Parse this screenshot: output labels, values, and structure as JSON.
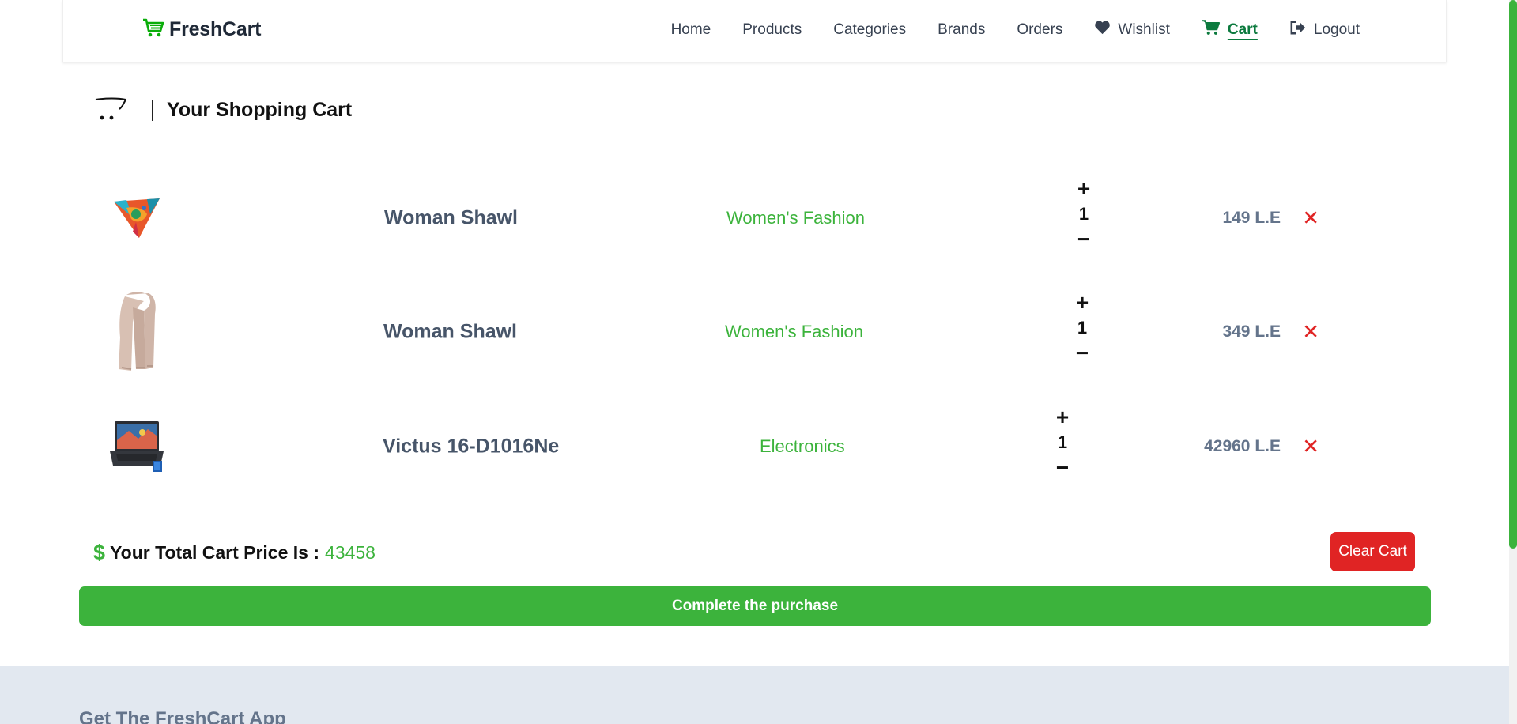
{
  "brand": {
    "name": "FreshCart",
    "icon": "shopping-cart-icon",
    "color": "#0aad0a"
  },
  "nav": {
    "items": [
      {
        "label": "Home"
      },
      {
        "label": "Products"
      },
      {
        "label": "Categories"
      },
      {
        "label": "Brands"
      },
      {
        "label": "Orders"
      },
      {
        "label": "Wishlist",
        "icon": "heart-icon"
      },
      {
        "label": "Cart",
        "icon": "cart-icon",
        "active": true
      },
      {
        "label": "Logout",
        "icon": "logout-icon"
      }
    ]
  },
  "cart": {
    "title": "Your Shopping Cart",
    "icon": "cart-outline-icon",
    "items": [
      {
        "name": "Woman Shawl",
        "category": "Women's Fashion",
        "quantity": "1",
        "price": "149 L.E",
        "image": "colorful-shawl-image"
      },
      {
        "name": "Woman Shawl",
        "category": "Women's Fashion",
        "quantity": "1",
        "price": "349 L.E",
        "image": "beige-scarf-image"
      },
      {
        "name": "Victus 16-D1016Ne",
        "category": "Electronics",
        "quantity": "1",
        "price": "42960 L.E",
        "image": "laptop-image"
      }
    ],
    "plus_symbol": "+",
    "minus_symbol": "−",
    "remove_symbol": "✕",
    "total_label": "Your Total Cart Price Is :",
    "total_value": "43458",
    "total_icon": "$",
    "clear_label": "Clear Cart",
    "purchase_label": "Complete the purchase"
  },
  "footer": {
    "title": "Get The FreshCart App"
  },
  "colors": {
    "accent": "#3cb33c",
    "danger": "#e02424",
    "nav_active": "#0c7a3e",
    "footer_bg": "#e2e8f0"
  }
}
